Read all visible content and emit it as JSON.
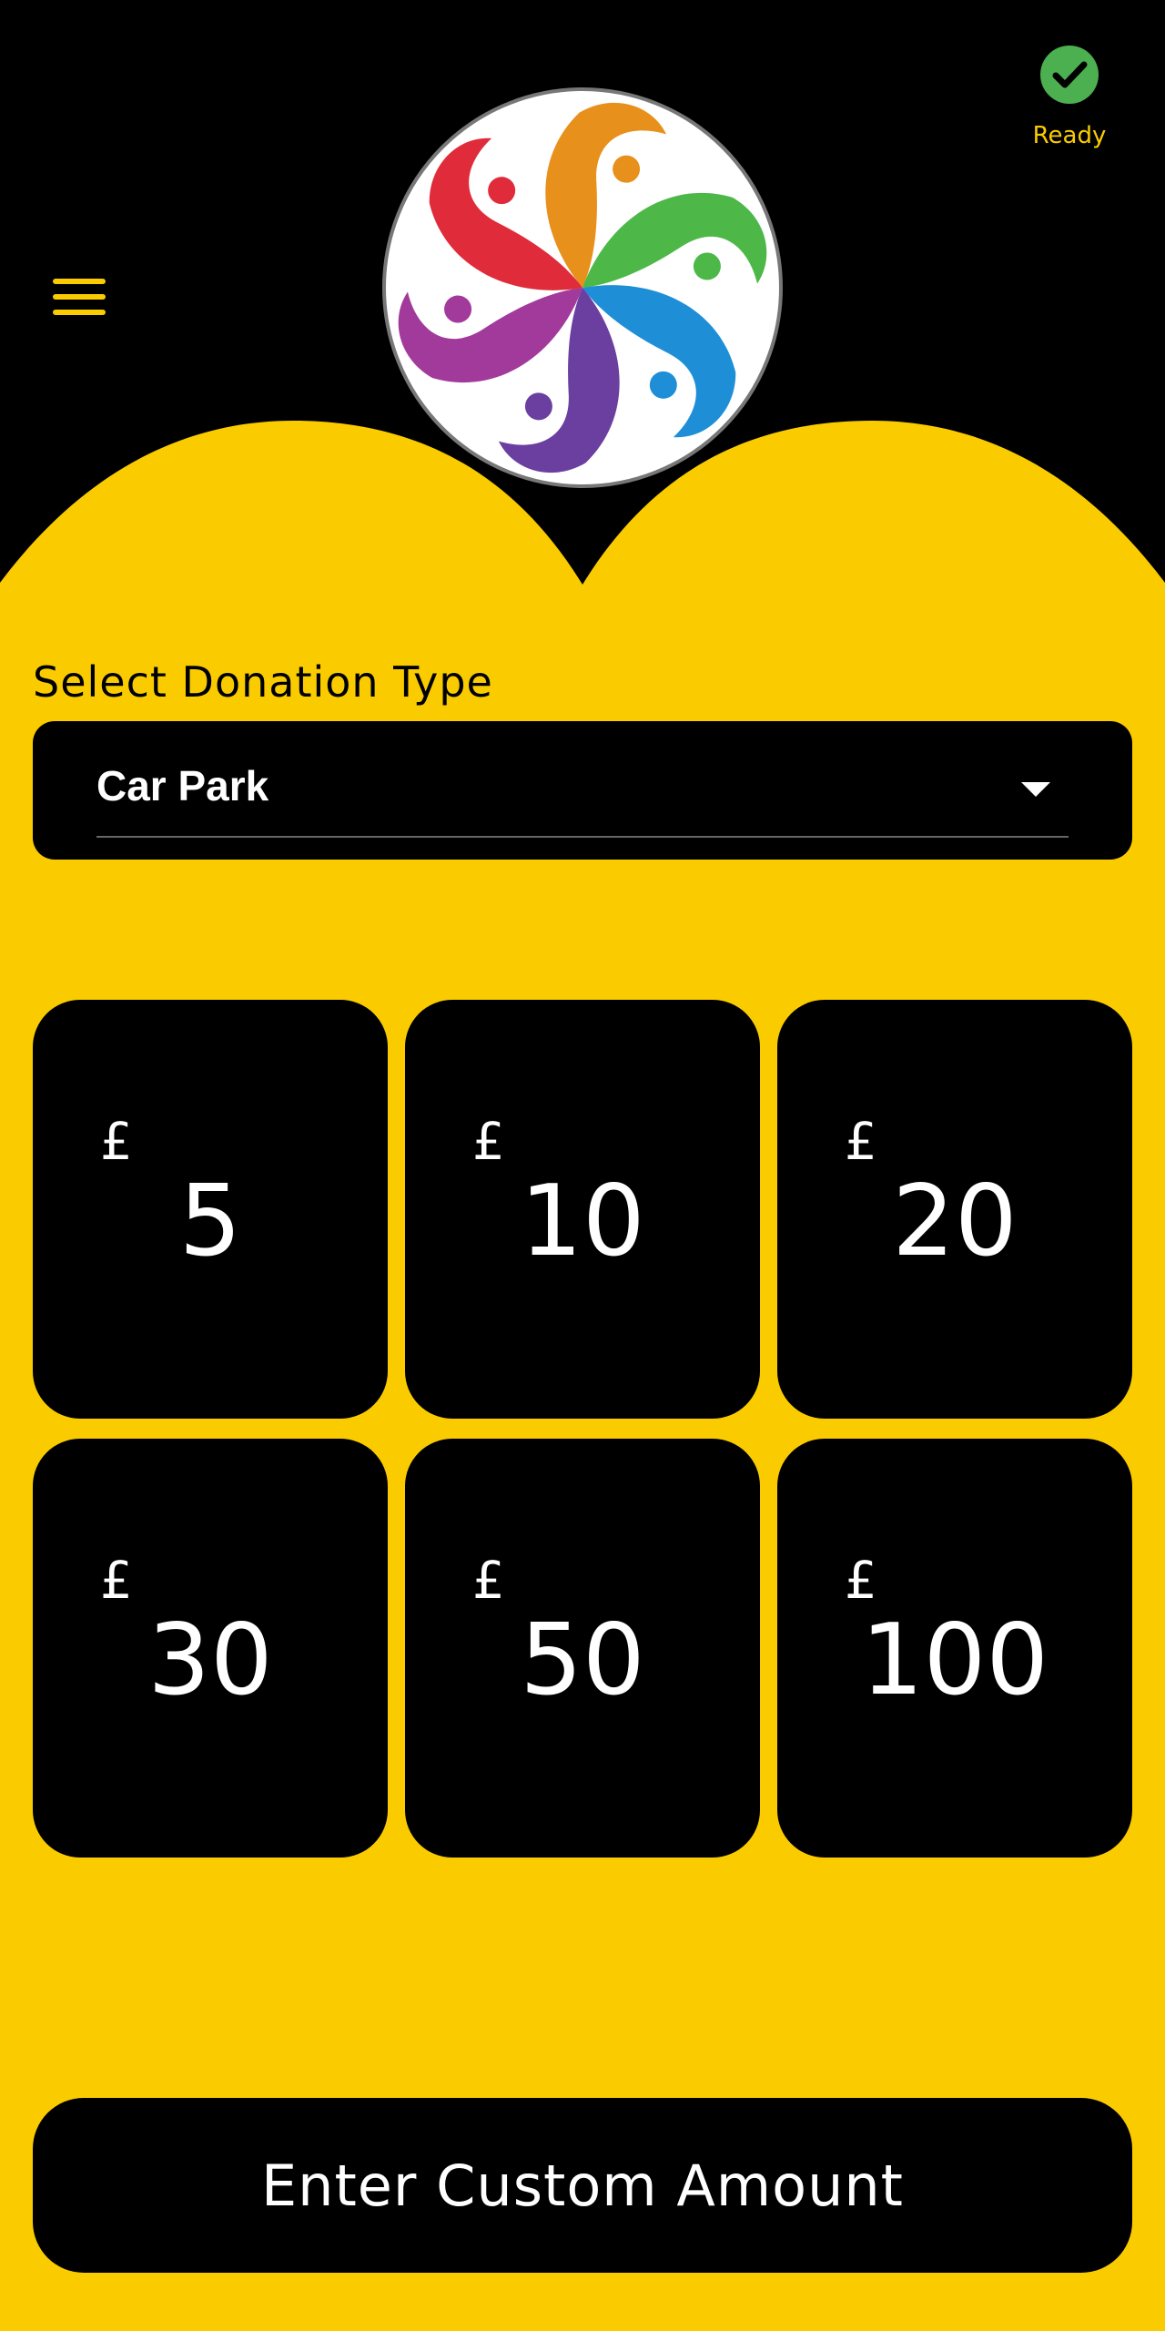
{
  "header": {
    "status_text": "Ready",
    "status_color": "#4CAF50",
    "menu_icon": "hamburger-menu-icon",
    "logo_icon": "rainbow-people-circle-logo"
  },
  "donation_type": {
    "label": "Select Donation Type",
    "selected": "Car Park"
  },
  "amounts": [
    {
      "currency": "£",
      "value": "5"
    },
    {
      "currency": "£",
      "value": "10"
    },
    {
      "currency": "£",
      "value": "20"
    },
    {
      "currency": "£",
      "value": "30"
    },
    {
      "currency": "£",
      "value": "50"
    },
    {
      "currency": "£",
      "value": "100"
    }
  ],
  "custom_button": {
    "label": "Enter Custom Amount"
  },
  "colors": {
    "accent_yellow": "#FACC00",
    "dark": "#000000",
    "ready_green": "#4CAF50"
  }
}
